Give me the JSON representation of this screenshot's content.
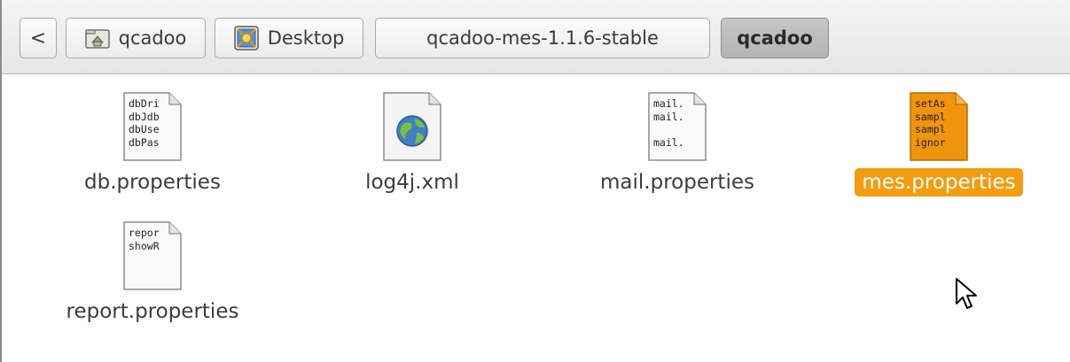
{
  "pathbar": {
    "back_label": "<",
    "crumbs": [
      {
        "label": "qcadoo",
        "icon": "home-folder-icon"
      },
      {
        "label": "Desktop",
        "icon": "desktop-icon"
      },
      {
        "label": "qcadoo-mes-1.1.6-stable"
      },
      {
        "label": "qcadoo",
        "active": true
      }
    ]
  },
  "files": [
    {
      "name": "db.properties",
      "preview": "dbDri\ndbJdb\ndbUse\ndbPas",
      "icon": "text-file-icon"
    },
    {
      "name": "log4j.xml",
      "icon": "xml-file-icon"
    },
    {
      "name": "mail.properties",
      "preview": "mail.\nmail.\n\nmail.",
      "icon": "text-file-icon"
    },
    {
      "name": "mes.properties",
      "preview": "setAs\nsampl\nsampl\nignor",
      "icon": "text-file-icon",
      "selected": true
    },
    {
      "name": "report.properties",
      "preview": "repor\nshowR",
      "icon": "text-file-icon"
    }
  ],
  "colors": {
    "selection": "#f39c0f",
    "pathbar_active": "#bdbdbd"
  }
}
